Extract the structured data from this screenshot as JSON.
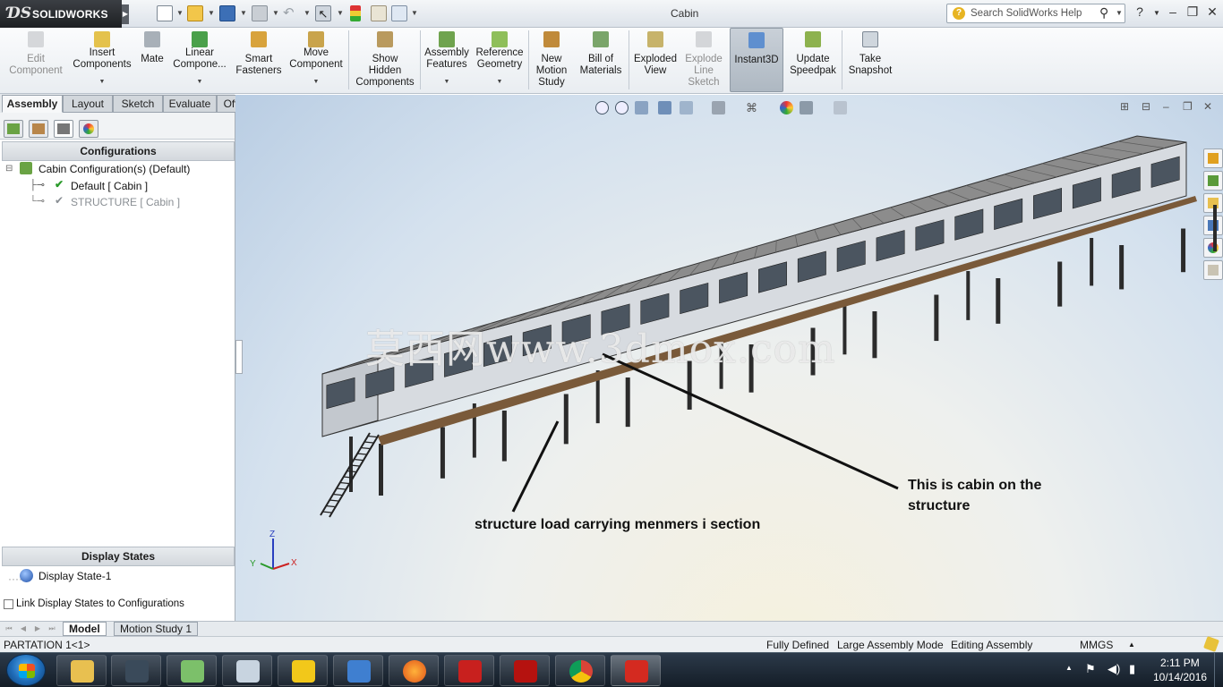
{
  "app": {
    "brand": "SOLIDWORKS",
    "document_title": "Cabin"
  },
  "search": {
    "placeholder": "Search SolidWorks Help"
  },
  "command_manager": [
    {
      "label": "Edit\nComponent",
      "icon": "edit-component-icon",
      "enabled": false,
      "dropdown": false
    },
    {
      "label": "Insert\nComponents",
      "icon": "insert-components-icon",
      "enabled": true,
      "dropdown": true
    },
    {
      "label": "Mate",
      "icon": "mate-icon",
      "enabled": true,
      "dropdown": false
    },
    {
      "label": "Linear\nCompone...",
      "icon": "linear-pattern-icon",
      "enabled": true,
      "dropdown": true
    },
    {
      "label": "Smart\nFasteners",
      "icon": "smart-fasteners-icon",
      "enabled": true,
      "dropdown": false
    },
    {
      "label": "Move\nComponent",
      "icon": "move-component-icon",
      "enabled": true,
      "dropdown": true
    },
    {
      "label": "Show\nHidden\nComponents",
      "icon": "show-hidden-icon",
      "enabled": true,
      "dropdown": false
    },
    {
      "label": "Assembly\nFeatures",
      "icon": "assembly-features-icon",
      "enabled": true,
      "dropdown": true
    },
    {
      "label": "Reference\nGeometry",
      "icon": "reference-geometry-icon",
      "enabled": true,
      "dropdown": true
    },
    {
      "label": "New\nMotion\nStudy",
      "icon": "motion-study-icon",
      "enabled": true,
      "dropdown": false
    },
    {
      "label": "Bill of\nMaterials",
      "icon": "bill-of-materials-icon",
      "enabled": true,
      "dropdown": false
    },
    {
      "label": "Exploded\nView",
      "icon": "exploded-view-icon",
      "enabled": true,
      "dropdown": false
    },
    {
      "label": "Explode\nLine\nSketch",
      "icon": "explode-line-sketch-icon",
      "enabled": false,
      "dropdown": false
    },
    {
      "label": "Instant3D",
      "icon": "instant3d-icon",
      "enabled": true,
      "dropdown": false,
      "active": true
    },
    {
      "label": "Update\nSpeedpak",
      "icon": "update-speedpak-icon",
      "enabled": true,
      "dropdown": false
    },
    {
      "label": "Take\nSnapshot",
      "icon": "take-snapshot-icon",
      "enabled": true,
      "dropdown": false
    }
  ],
  "tabs": [
    "Assembly",
    "Layout",
    "Sketch",
    "Evaluate",
    "Office Products"
  ],
  "active_tab": "Assembly",
  "configurations": {
    "header": "Configurations",
    "root": "Cabin Configuration(s)  (Default)",
    "items": [
      {
        "label": "Default [ Cabin ]",
        "active": true
      },
      {
        "label": "STRUCTURE [ Cabin ]",
        "active": false
      }
    ]
  },
  "display_states": {
    "header": "Display States",
    "items": [
      "Display State-1"
    ],
    "link_label": "Link Display States to Configurations",
    "link_checked": false
  },
  "viewport": {
    "watermark": "莫西网www.3dmox.com",
    "annotation_cabin": "This is cabin on the\nstructure",
    "annotation_structure": "structure load carrying menmers i section",
    "triad": {
      "x": "X",
      "y": "Y",
      "z": "Z"
    }
  },
  "bottom_tabs": [
    "Model",
    "Motion Study 1"
  ],
  "active_bottom_tab": "Model",
  "status": {
    "part": "PARTATION 1<1>",
    "state": "Fully Defined",
    "mode": "Large Assembly Mode",
    "editing": "Editing Assembly",
    "units": "MMGS"
  },
  "taskbar": {
    "apps": [
      "file-explorer",
      "solidworks-composer",
      "sketchbook",
      "calculator",
      "norton",
      "edrawings",
      "firefox",
      "autocad",
      "acrobat",
      "chrome",
      "solidworks"
    ],
    "time": "2:11 PM",
    "date": "10/14/2016"
  },
  "colors": {
    "accent": "#1f6cb8",
    "structure_deck": "#7a5a3a",
    "structure_steel": "#2b2b2b",
    "roof": "#8c8c8c"
  }
}
